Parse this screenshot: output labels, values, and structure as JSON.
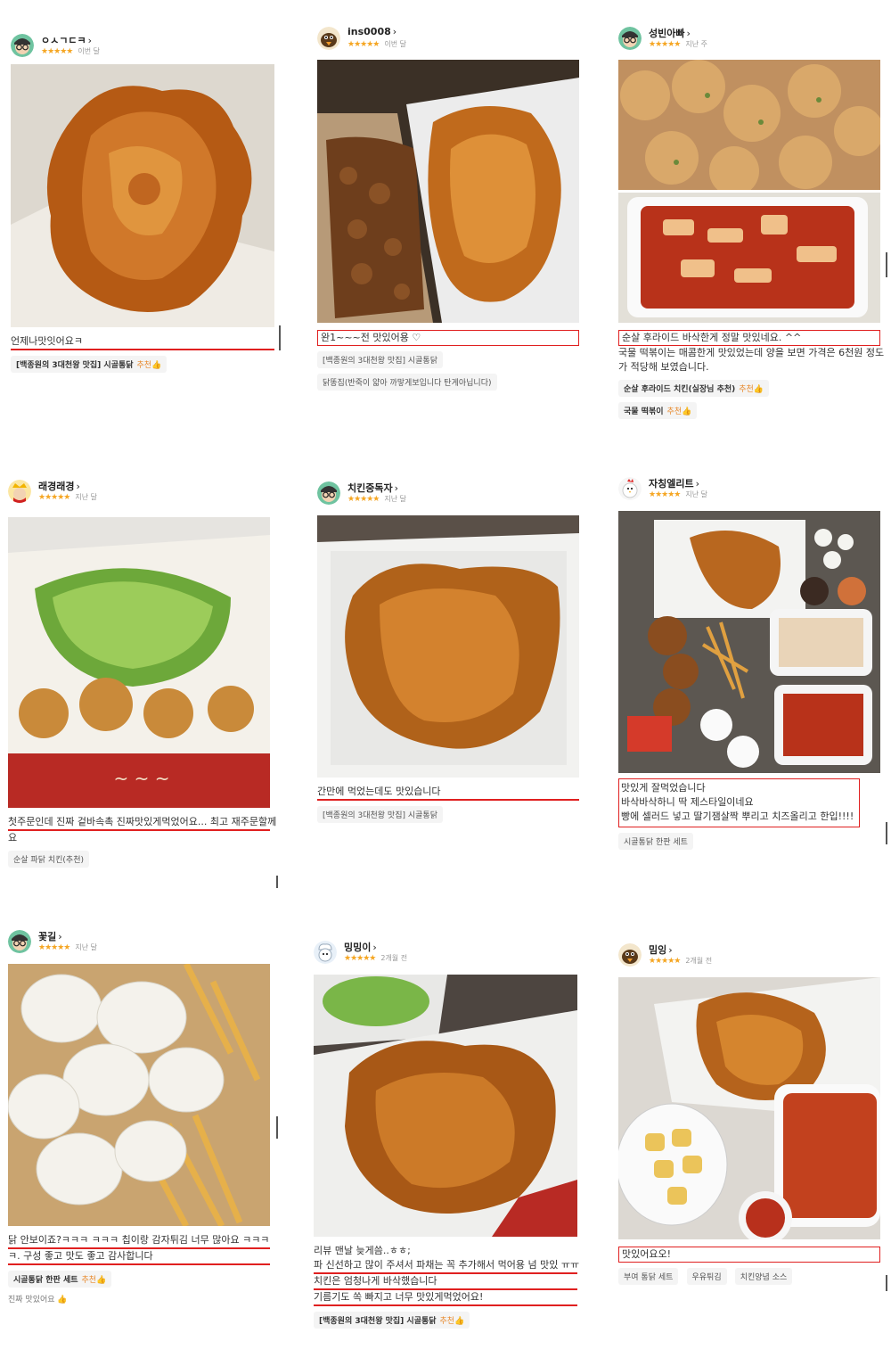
{
  "reviews": [
    {
      "user": "ㅇㅅㄱㄷㅋ",
      "date": "이번 달",
      "stars": "★★★★★",
      "avatar": "avatar-glasses",
      "text": [
        "언제나맛잇어요ㅋ"
      ],
      "tags": [
        {
          "label": "[백종원의 3대천왕 맛집] 시골통닭",
          "rec": "추천👍"
        }
      ]
    },
    {
      "user": "ins0008",
      "date": "이번 달",
      "stars": "★★★★★",
      "avatar": "avatar-bird",
      "text": [
        "완1~~~전 맛있어용 ♡"
      ],
      "tags": [
        {
          "label": "[백종원의 3대천왕 맛집] 시골통닭"
        },
        {
          "label": "닭똥집(반죽이 얇아 까맣게보입니다 탄게아닙니다)"
        }
      ]
    },
    {
      "user": "성빈아빠",
      "date": "지난 주",
      "stars": "★★★★★",
      "avatar": "avatar-glasses",
      "text": [
        "순살 후라이드 바삭한게 정말 맛있네요. ^^",
        "국물 떡볶이는 매콤한게 맛있었는데 양을 보면 가격은 6천원 정도",
        "가 적당해 보였습니다."
      ],
      "tags": [
        {
          "label": "순살 후라이드 치킨(실장님 추천)",
          "rec": "추천👍"
        },
        {
          "label": "국물 떡볶이",
          "rec": "추천👍"
        }
      ]
    },
    {
      "user": "래경래경",
      "date": "지난 달",
      "stars": "★★★★★",
      "avatar": "avatar-crown",
      "text": [
        "첫주문인데 진짜 겉바속촉 진짜맛있게먹었어요... 최고 재주문할께",
        "요"
      ],
      "tags": [
        {
          "label": "순살 파닭 치킨(추천)"
        }
      ]
    },
    {
      "user": "치킨중독자",
      "date": "지난 달",
      "stars": "★★★★★",
      "avatar": "avatar-glasses",
      "text": [
        "간만에 먹었는데도 맛있습니다"
      ],
      "tags": [
        {
          "label": "[백종원의 3대천왕 맛집] 시골통닭"
        }
      ]
    },
    {
      "user": "자칭엘리트",
      "date": "지난 달",
      "stars": "★★★★★",
      "avatar": "avatar-chicken",
      "text": [
        "맛있게 잘먹었습니다",
        "바삭바삭하니 딱 제스타일이네요",
        "빵에 셀러드 넣고 딸기잼살짝 뿌리고 치즈올리고 한입!!!!"
      ],
      "tags": [
        {
          "label": "시골통닭 한판 세트"
        }
      ]
    },
    {
      "user": "꽃길",
      "date": "지난 달",
      "stars": "★★★★★",
      "avatar": "avatar-glasses",
      "text": [
        "닭 안보이죠?ㅋㅋㅋ ㅋㅋㅋ 칩이랑 감자튀김 너무 많아요 ㅋㅋㅋ",
        "ㅋ. 구성 좋고 맛도 좋고 감사합니다"
      ],
      "tags": [
        {
          "label": "시골통닭 한판 세트",
          "rec": "추천👍"
        }
      ],
      "extra": "진짜 맛있어요 👍"
    },
    {
      "user": "밍밍이",
      "date": "2개월 전",
      "stars": "★★★★★",
      "avatar": "avatar-chef",
      "text": [
        "리뷰 맨날 늦게씀..ㅎㅎ;",
        "파 신선하고 많이 주셔서 파채는 꼭 추가해서 먹어용 넘 맛있 ㅠㅠ",
        "치킨은 엄청나게 바삭했습니다",
        "기름기도 쏙 빠지고 너무 맛있게먹었어요!"
      ],
      "tags": [
        {
          "label": "[백종원의 3대천왕 맛집] 시골통닭",
          "rec": "추천👍"
        }
      ]
    },
    {
      "user": "밈잉",
      "date": "2개월 전",
      "stars": "★★★★★",
      "avatar": "avatar-bird",
      "text": [
        "맛있어요오!"
      ],
      "tags": [
        {
          "label": "부여 통닭 세트"
        },
        {
          "label": "우유튀김"
        },
        {
          "label": "치킨양념 소스"
        }
      ]
    }
  ],
  "colors": {
    "star": "#f5a623",
    "recommend": "#e88a2e",
    "highlight": "#e02020"
  }
}
